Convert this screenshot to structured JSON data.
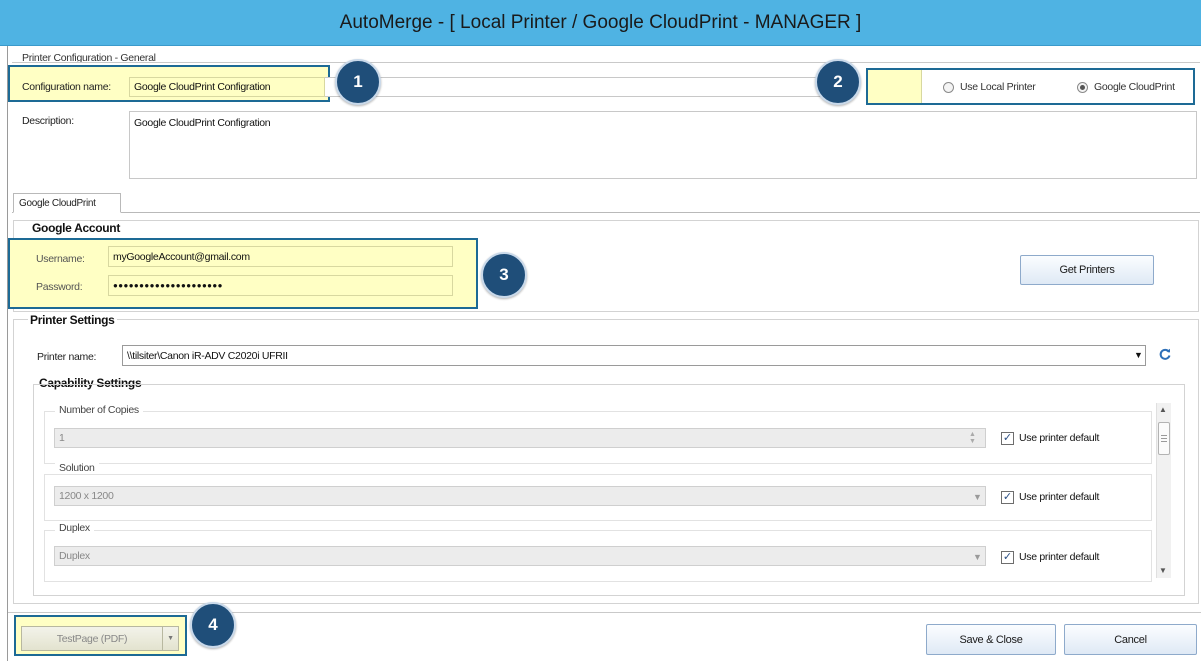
{
  "window": {
    "title": "AutoMerge - [ Local Printer / Google CloudPrint - MANAGER ]"
  },
  "general": {
    "section_label": "Printer Configuration - General",
    "config_name_label": "Configuration name:",
    "config_name_value": "Google CloudPrint Configration",
    "description_label": "Description:",
    "description_value": "Google CloudPrint Configration",
    "printer_type": {
      "options": [
        {
          "label": "Use Local Printer",
          "selected": false
        },
        {
          "label": "Google CloudPrint",
          "selected": true
        }
      ]
    }
  },
  "tabs": [
    {
      "label": "Google CloudPrint",
      "active": true
    }
  ],
  "google_account": {
    "header": "Google Account",
    "username_label": "Username:",
    "username_value": "myGoogleAccount@gmail.com",
    "password_label": "Password:",
    "password_value": "●●●●●●●●●●●●●●●●●●●●●",
    "get_printers_label": "Get Printers"
  },
  "printer_settings": {
    "header": "Printer Settings",
    "printer_name_label": "Printer name:",
    "printer_name_value": "\\\\tilsiter\\Canon iR-ADV C2020i UFRII",
    "refresh_icon": "refresh-icon"
  },
  "capability_settings": {
    "header": "Capability Settings",
    "items": [
      {
        "label": "Number of Copies",
        "value": "1",
        "control": "spinner",
        "use_default_label": "Use printer default",
        "use_default": true
      },
      {
        "label": "Solution",
        "value": "1200 x 1200",
        "control": "dropdown",
        "use_default_label": "Use printer default",
        "use_default": true
      },
      {
        "label": "Duplex",
        "value": "Duplex",
        "control": "dropdown",
        "use_default_label": "Use printer default",
        "use_default": true
      }
    ]
  },
  "footer": {
    "testpage_label": "TestPage (PDF)",
    "save_close_label": "Save & Close",
    "cancel_label": "Cancel"
  },
  "callouts": [
    "1",
    "2",
    "3",
    "4"
  ],
  "colors": {
    "titlebar": "#4fb3e3",
    "callout_badge": "#1f4e79",
    "highlight_border": "#1d6a95",
    "highlight_fill": "#ffffc4",
    "button_border": "#8eaacb"
  }
}
